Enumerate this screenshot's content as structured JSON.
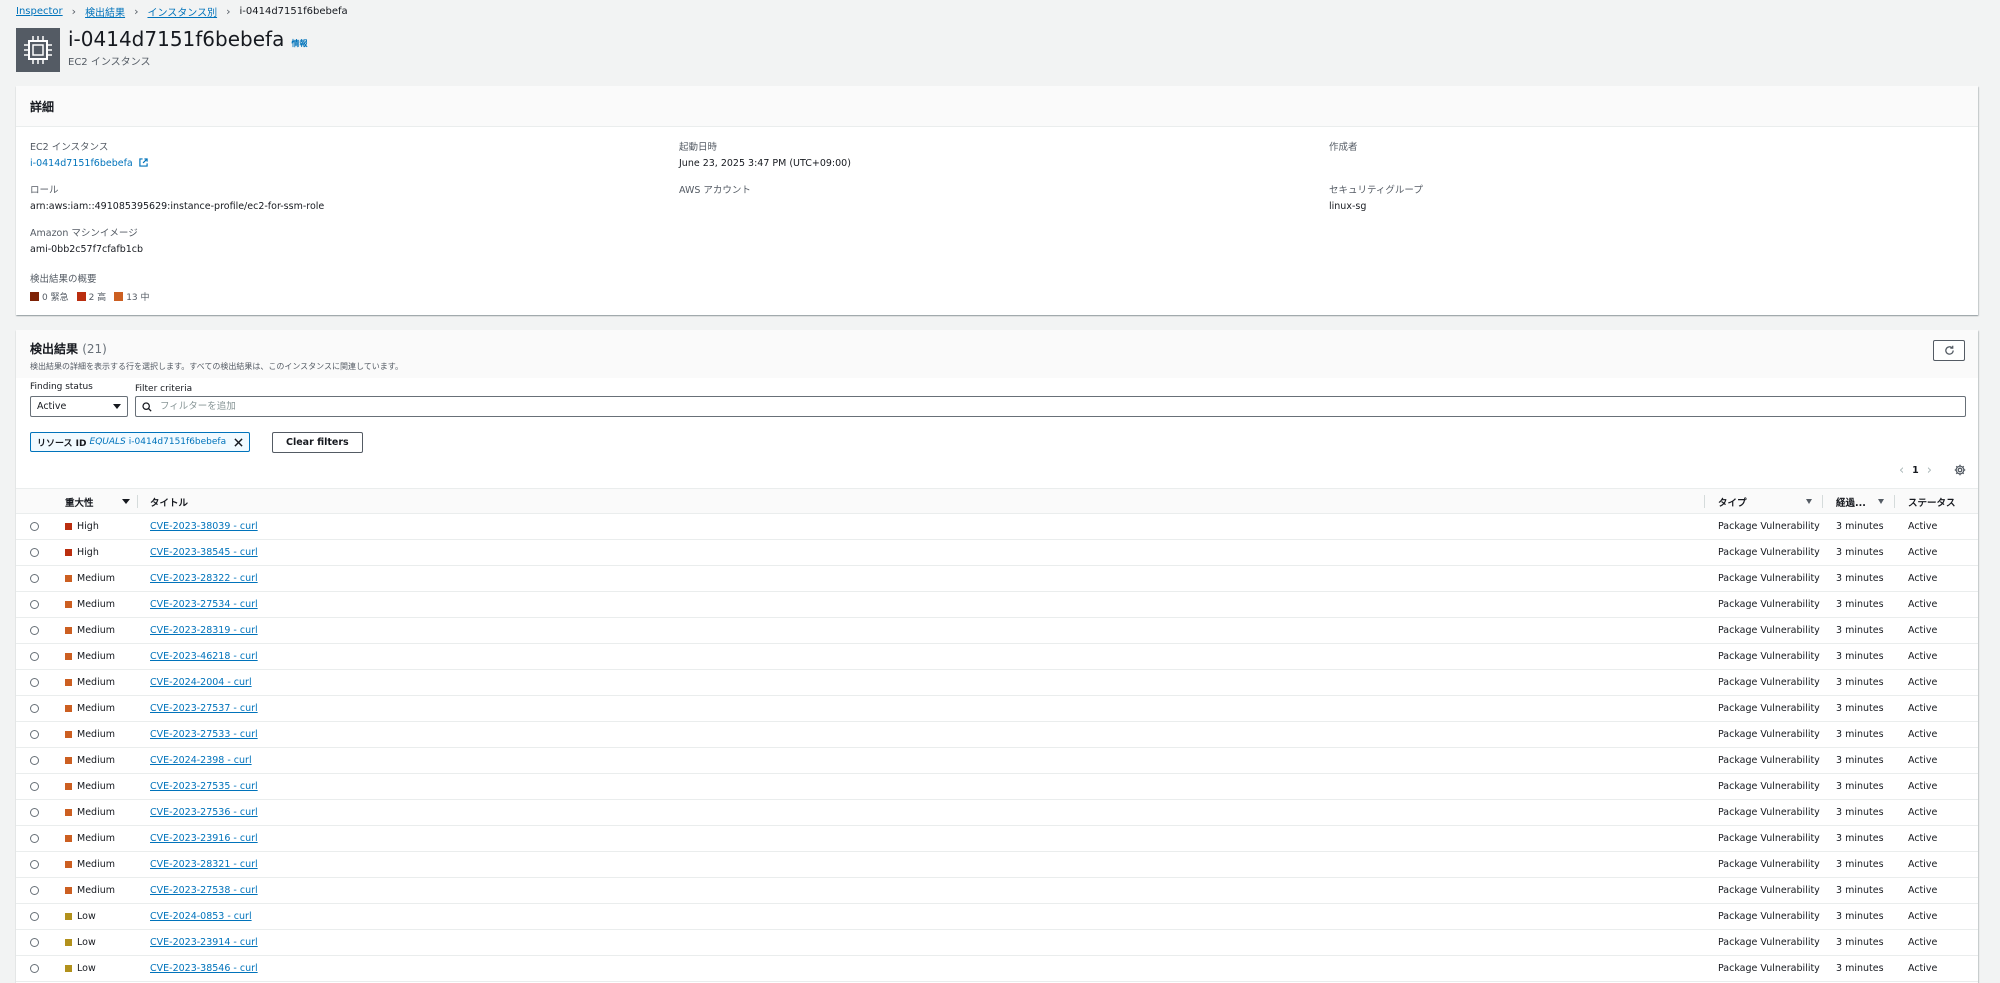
{
  "breadcrumb": {
    "items": [
      "Inspector",
      "検出結果",
      "インスタンス別"
    ],
    "current": "i-0414d7151f6bebefa"
  },
  "header": {
    "title": "i-0414d7151f6bebefa",
    "info": "情報",
    "subtitle": "EC2 インスタンス",
    "icon": "ec2-instance-icon"
  },
  "details": {
    "title": "詳細",
    "ec2_instance": {
      "label": "EC2 インスタンス",
      "value": "i-0414d7151f6bebefa"
    },
    "launch_time": {
      "label": "起動日時",
      "value": "June 23, 2025 3:47 PM (UTC+09:00)"
    },
    "created_by": {
      "label": "作成者",
      "value": ""
    },
    "role": {
      "label": "ロール",
      "value": "arn:aws:iam::491085395629:instance-profile/ec2-for-ssm-role"
    },
    "aws_account": {
      "label": "AWS アカウント",
      "value": ""
    },
    "security_group": {
      "label": "セキュリティグループ",
      "value": "linux-sg"
    },
    "ami": {
      "label": "Amazon マシンイメージ",
      "value": "ami-0bb2c57f7cfafb1cb"
    },
    "summary": {
      "label": "検出結果の概要",
      "critical": "0 緊急",
      "high": "2 高",
      "medium": "13 中"
    }
  },
  "findings": {
    "title": "検出結果",
    "count": "(21)",
    "description": "検出結果の詳細を表示する行を選択します。すべての検出結果は、このインスタンスに関連しています。",
    "status_label": "Finding status",
    "status_value": "Active",
    "filter_label": "Filter criteria",
    "filter_placeholder": "フィルターを追加",
    "token": {
      "key": "リソース ID",
      "op": "EQUALS",
      "value": "i-0414d7151f6bebefa"
    },
    "clear_filters": "Clear filters",
    "page": "1",
    "columns": {
      "severity": "重大性",
      "title": "タイトル",
      "type": "タイプ",
      "age": "経過...",
      "status": "ステータス"
    },
    "rows": [
      {
        "severity": "High",
        "title": "CVE-2023-38039 - curl",
        "type": "Package Vulnerability",
        "age": "3 minutes",
        "status": "Active"
      },
      {
        "severity": "High",
        "title": "CVE-2023-38545 - curl",
        "type": "Package Vulnerability",
        "age": "3 minutes",
        "status": "Active"
      },
      {
        "severity": "Medium",
        "title": "CVE-2023-28322 - curl",
        "type": "Package Vulnerability",
        "age": "3 minutes",
        "status": "Active"
      },
      {
        "severity": "Medium",
        "title": "CVE-2023-27534 - curl",
        "type": "Package Vulnerability",
        "age": "3 minutes",
        "status": "Active"
      },
      {
        "severity": "Medium",
        "title": "CVE-2023-28319 - curl",
        "type": "Package Vulnerability",
        "age": "3 minutes",
        "status": "Active"
      },
      {
        "severity": "Medium",
        "title": "CVE-2023-46218 - curl",
        "type": "Package Vulnerability",
        "age": "3 minutes",
        "status": "Active"
      },
      {
        "severity": "Medium",
        "title": "CVE-2024-2004 - curl",
        "type": "Package Vulnerability",
        "age": "3 minutes",
        "status": "Active"
      },
      {
        "severity": "Medium",
        "title": "CVE-2023-27537 - curl",
        "type": "Package Vulnerability",
        "age": "3 minutes",
        "status": "Active"
      },
      {
        "severity": "Medium",
        "title": "CVE-2023-27533 - curl",
        "type": "Package Vulnerability",
        "age": "3 minutes",
        "status": "Active"
      },
      {
        "severity": "Medium",
        "title": "CVE-2024-2398 - curl",
        "type": "Package Vulnerability",
        "age": "3 minutes",
        "status": "Active"
      },
      {
        "severity": "Medium",
        "title": "CVE-2023-27535 - curl",
        "type": "Package Vulnerability",
        "age": "3 minutes",
        "status": "Active"
      },
      {
        "severity": "Medium",
        "title": "CVE-2023-27536 - curl",
        "type": "Package Vulnerability",
        "age": "3 minutes",
        "status": "Active"
      },
      {
        "severity": "Medium",
        "title": "CVE-2023-23916 - curl",
        "type": "Package Vulnerability",
        "age": "3 minutes",
        "status": "Active"
      },
      {
        "severity": "Medium",
        "title": "CVE-2023-28321 - curl",
        "type": "Package Vulnerability",
        "age": "3 minutes",
        "status": "Active"
      },
      {
        "severity": "Medium",
        "title": "CVE-2023-27538 - curl",
        "type": "Package Vulnerability",
        "age": "3 minutes",
        "status": "Active"
      },
      {
        "severity": "Low",
        "title": "CVE-2024-0853 - curl",
        "type": "Package Vulnerability",
        "age": "3 minutes",
        "status": "Active"
      },
      {
        "severity": "Low",
        "title": "CVE-2023-23914 - curl",
        "type": "Package Vulnerability",
        "age": "3 minutes",
        "status": "Active"
      },
      {
        "severity": "Low",
        "title": "CVE-2023-38546 - curl",
        "type": "Package Vulnerability",
        "age": "3 minutes",
        "status": "Active"
      }
    ]
  },
  "colors": {
    "critical": "#7d2105",
    "high": "#ba2e0f",
    "medium": "#cc5f21",
    "low": "#b2911c",
    "link": "#0073bb"
  }
}
